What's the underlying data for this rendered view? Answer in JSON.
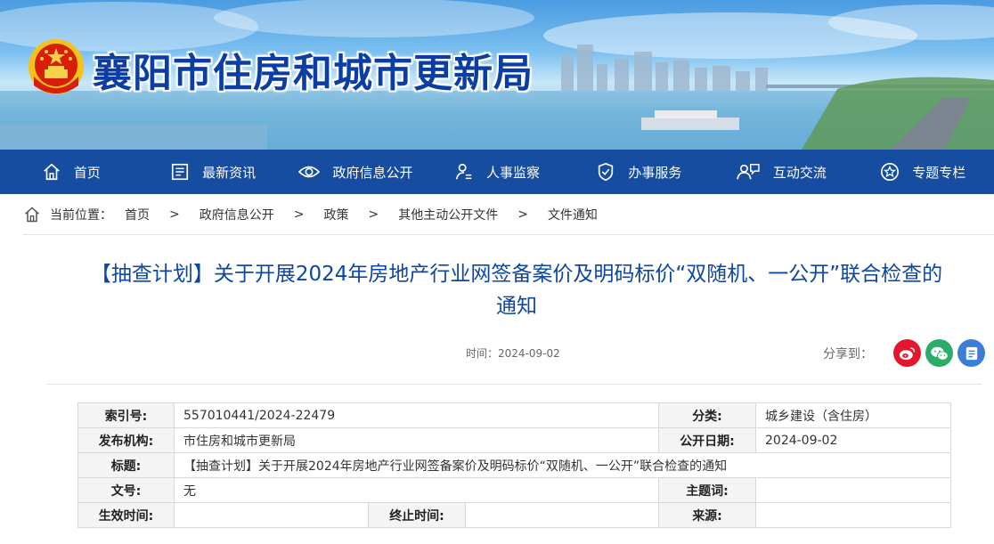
{
  "site": {
    "title": "襄阳市住房和城市更新局"
  },
  "nav": {
    "items": [
      {
        "label": "首页",
        "icon": "home-icon"
      },
      {
        "label": "最新资讯",
        "icon": "news-icon"
      },
      {
        "label": "政府信息公开",
        "icon": "eye-icon"
      },
      {
        "label": "人事监察",
        "icon": "person-icon"
      },
      {
        "label": "办事服务",
        "icon": "shield-icon"
      },
      {
        "label": "互动交流",
        "icon": "chat-people-icon"
      },
      {
        "label": "专题专栏",
        "icon": "star-icon"
      }
    ]
  },
  "breadcrumb": {
    "prefix": "当前位置：",
    "separator": ">",
    "items": [
      "首页",
      "政府信息公开",
      "政策",
      "其他主动公开文件",
      "文件通知"
    ]
  },
  "article": {
    "title": "【抽查计划】关于开展2024年房地产行业网签备案价及明码标价“双随机、一公开”联合检查的通知",
    "time": "时间：2024-09-02",
    "share_label": "分享到："
  },
  "share": {
    "weibo_color": "#e6162d",
    "wechat_color": "#2aae67",
    "other_color": "#3b7ed8"
  },
  "info": {
    "index_no_label": "索引号:",
    "index_no": "557010441/2024-22479",
    "category_label": "分类:",
    "category": "城乡建设（含住房）",
    "publisher_label": "发布机构:",
    "publisher": "市住房和城市更新局",
    "pub_date_label": "公开日期:",
    "pub_date": "2024-09-02",
    "title_label": "标题:",
    "title": "【抽查计划】关于开展2024年房地产行业网签备案价及明码标价“双随机、一公开”联合检查的通知",
    "doc_no_label": "文号:",
    "doc_no": "无",
    "keywords_label": "主题词:",
    "keywords": "",
    "effective_label": "生效时间:",
    "effective": "",
    "expire_label": "终止时间:",
    "expire": "",
    "source_label": "来源:",
    "source": ""
  }
}
